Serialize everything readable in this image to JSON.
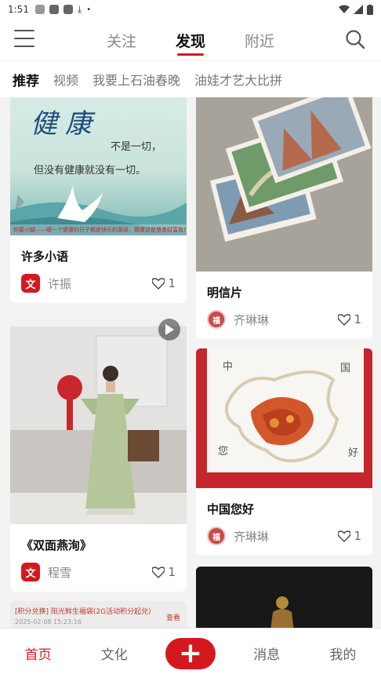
{
  "status_bar": {
    "time": "1:51"
  },
  "header": {
    "tabs": [
      {
        "label": "关注",
        "active": false
      },
      {
        "label": "发现",
        "active": true
      },
      {
        "label": "附近",
        "active": false
      }
    ]
  },
  "sub_tabs": [
    {
      "label": "推荐",
      "active": true
    },
    {
      "label": "视频",
      "active": false
    },
    {
      "label": "我要上石油春晚",
      "active": false
    },
    {
      "label": "油娃才艺大比拼",
      "active": false
    }
  ],
  "cards": {
    "c1": {
      "title": "许多小语",
      "author": "许振",
      "likes": "1",
      "avatar": "文",
      "image_text": {
        "line1": "健康",
        "line2": "不是一切，",
        "line3": "但没有健康就没有一切。",
        "banner": "你要小腿——哪一个健康的日子都是快乐的源泉，健康这是慧者财富有！"
      }
    },
    "c2": {
      "title": "明信片",
      "author": "齐琳琳",
      "likes": "1",
      "avatar": "福"
    },
    "c3": {
      "title": "《双面燕洵》",
      "author": "程雪",
      "likes": "1",
      "avatar": "文"
    },
    "c4": {
      "title": "中国您好",
      "author": "齐琳琳",
      "likes": "1",
      "avatar": "福",
      "image_text": {
        "tl": "中",
        "tr": "国",
        "bl": "您",
        "br": "好"
      }
    },
    "c5": {
      "image_text": {
        "line1": "[积分兑换] 阳光鲜生福袋(2G活动积分起兑)",
        "line2": "2025-02-08 15:23:16",
        "action": "查看"
      }
    }
  },
  "bottom_nav": {
    "home": "首页",
    "culture": "文化",
    "add": "+",
    "messages": "消息",
    "mine": "我的"
  },
  "colors": {
    "accent": "#d4191e"
  }
}
